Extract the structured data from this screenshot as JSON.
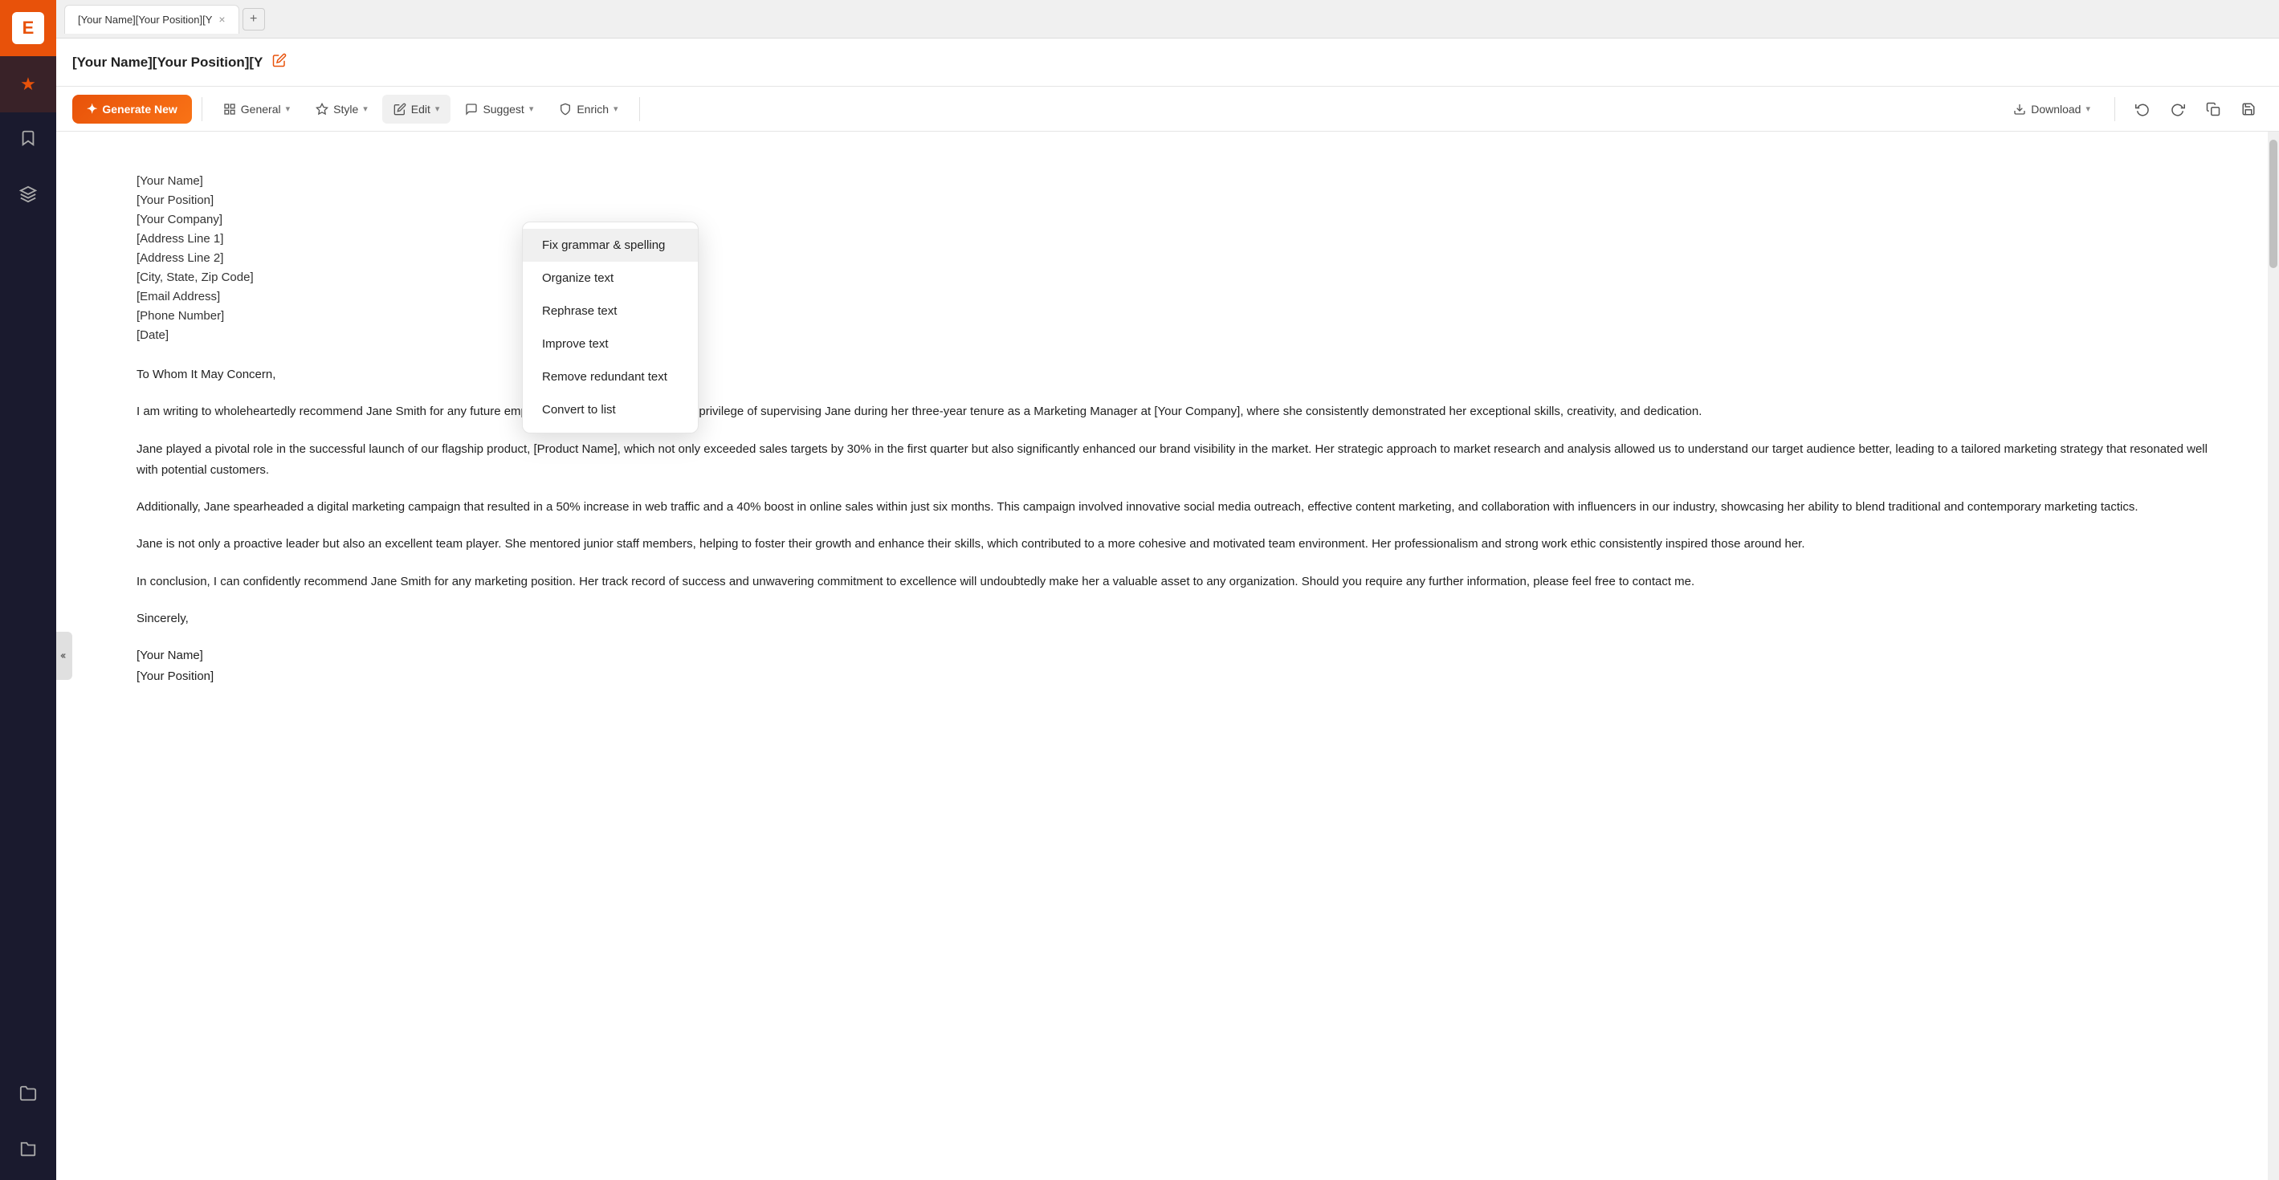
{
  "sidebar": {
    "logo": "E",
    "nav_items": [
      {
        "id": "star",
        "icon": "★",
        "active": true
      },
      {
        "id": "bookmark",
        "icon": "🔖",
        "active": false
      },
      {
        "id": "layers",
        "icon": "⬡",
        "active": false
      },
      {
        "id": "folder1",
        "icon": "📁",
        "active": false
      },
      {
        "id": "folder2",
        "icon": "📂",
        "active": false
      }
    ]
  },
  "tab": {
    "title": "[Your Name][Your Position][Y",
    "close_icon": "×",
    "add_icon": "+"
  },
  "doc_header": {
    "title": "[Your Name][Your Position][Y",
    "edit_icon": "✎"
  },
  "toolbar": {
    "generate_label": "Generate New",
    "generate_icon": "✦",
    "menus": [
      {
        "id": "general",
        "label": "General",
        "icon": "⊞"
      },
      {
        "id": "style",
        "label": "Style",
        "icon": "🖌"
      },
      {
        "id": "edit",
        "label": "Edit",
        "icon": "✏"
      },
      {
        "id": "suggest",
        "label": "Suggest",
        "icon": "💬"
      },
      {
        "id": "enrich",
        "label": "Enrich",
        "icon": "🌱"
      }
    ],
    "download_label": "Download",
    "download_icon": "⬇",
    "undo_icon": "↩",
    "redo_icon": "↪",
    "copy_icon": "⧉",
    "save_icon": "💾"
  },
  "dropdown": {
    "items": [
      {
        "id": "fix-grammar",
        "label": "Fix grammar & spelling",
        "highlighted": true
      },
      {
        "id": "organize-text",
        "label": "Organize text",
        "highlighted": false
      },
      {
        "id": "rephrase-text",
        "label": "Rephrase text",
        "highlighted": false
      },
      {
        "id": "improve-text",
        "label": "Improve text",
        "highlighted": false
      },
      {
        "id": "remove-redundant",
        "label": "Remove redundant text",
        "highlighted": false
      },
      {
        "id": "convert-list",
        "label": "Convert to list",
        "highlighted": false
      }
    ]
  },
  "document": {
    "address_lines": [
      "[Your Name]",
      "[Your Position]",
      "[Your Company]",
      "[Address Line 1]",
      "[Address Line 2]",
      "[City, State, Zip Code]",
      "[Email Address]",
      "[Phone Number]",
      "[Date]"
    ],
    "salutation": "To Whom It May Concern,",
    "paragraphs": [
      "I am writing to wholeheartedly recommend Jane Smith for any future employment opportunities. I had the privilege of supervising Jane during her three-year tenure as a Marketing Manager at [Your Company], where she consistently demonstrated her exceptional skills, creativity, and dedication.",
      "Jane played a pivotal role in the successful launch of our flagship product, [Product Name], which not only exceeded sales targets by 30% in the first quarter but also significantly enhanced our brand visibility in the market. Her strategic approach to market research and analysis allowed us to understand our target audience better, leading to a tailored marketing strategy that resonated well with potential customers.",
      "Additionally, Jane spearheaded a digital marketing campaign that resulted in a 50% increase in web traffic and a 40% boost in online sales within just six months. This campaign involved innovative social media outreach, effective content marketing, and collaboration with influencers in our industry, showcasing her ability to blend traditional and contemporary marketing tactics.",
      "Jane is not only a proactive leader but also an excellent team player. She mentored junior staff members, helping to foster their growth and enhance their skills, which contributed to a more cohesive and motivated team environment. Her professionalism and strong work ethic consistently inspired those around her.",
      "In conclusion, I can confidently recommend Jane Smith for any marketing position. Her track record of success and unwavering commitment to excellence will undoubtedly make her a valuable asset to any organization. Should you require any further information, please feel free to contact me."
    ],
    "closing": "Sincerely,",
    "closing_lines": [
      "[Your Name]",
      "[Your Position]"
    ]
  }
}
